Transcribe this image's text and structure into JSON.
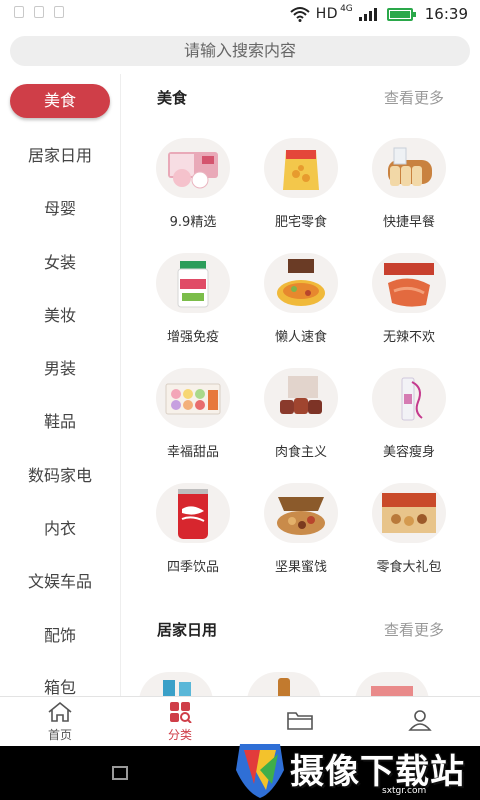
{
  "status_bar": {
    "network": "HD",
    "network_gen": "4G",
    "time": "16:39"
  },
  "search": {
    "placeholder": "请输入搜索内容"
  },
  "sidebar": {
    "items": [
      {
        "label": "美食",
        "active": true
      },
      {
        "label": "居家日用"
      },
      {
        "label": "母婴"
      },
      {
        "label": "女装"
      },
      {
        "label": "美妆"
      },
      {
        "label": "男装"
      },
      {
        "label": "鞋品"
      },
      {
        "label": "数码家电"
      },
      {
        "label": "内衣"
      },
      {
        "label": "文娱车品"
      },
      {
        "label": "配饰"
      },
      {
        "label": "箱包"
      }
    ]
  },
  "sections": [
    {
      "title": "美食",
      "more": "查看更多",
      "items": [
        {
          "label": "9.9精选",
          "icon": "dessert-box-image"
        },
        {
          "label": "肥宅零食",
          "icon": "snack-bag-image"
        },
        {
          "label": "快捷早餐",
          "icon": "bread-image"
        },
        {
          "label": "增强免疫",
          "icon": "supplement-jar-image"
        },
        {
          "label": "懒人速食",
          "icon": "instant-noodles-image"
        },
        {
          "label": "无辣不欢",
          "icon": "spicy-meat-image"
        },
        {
          "label": "幸福甜品",
          "icon": "macaron-box-image"
        },
        {
          "label": "肉食主义",
          "icon": "braised-meat-image"
        },
        {
          "label": "美容瘦身",
          "icon": "slimming-drink-image"
        },
        {
          "label": "四季饮品",
          "icon": "cola-can-image"
        },
        {
          "label": "坚果蜜饯",
          "icon": "nuts-gift-box-image"
        },
        {
          "label": "零食大礼包",
          "icon": "snack-gift-box-image"
        }
      ]
    },
    {
      "title": "居家日用",
      "more": "查看更多"
    }
  ],
  "tab_bar": {
    "tabs": [
      {
        "label": "首页",
        "icon": "home-icon"
      },
      {
        "label": "分类",
        "icon": "category-icon",
        "active": true
      },
      {
        "label": "",
        "icon": "folder-icon"
      },
      {
        "label": "",
        "icon": "user-icon"
      }
    ]
  },
  "watermark": {
    "text": "摄像下载站",
    "url": "sxtgr.com"
  },
  "colors": {
    "accent": "#cf3e48",
    "battery": "#2aa84a",
    "background": "#ffffff"
  }
}
